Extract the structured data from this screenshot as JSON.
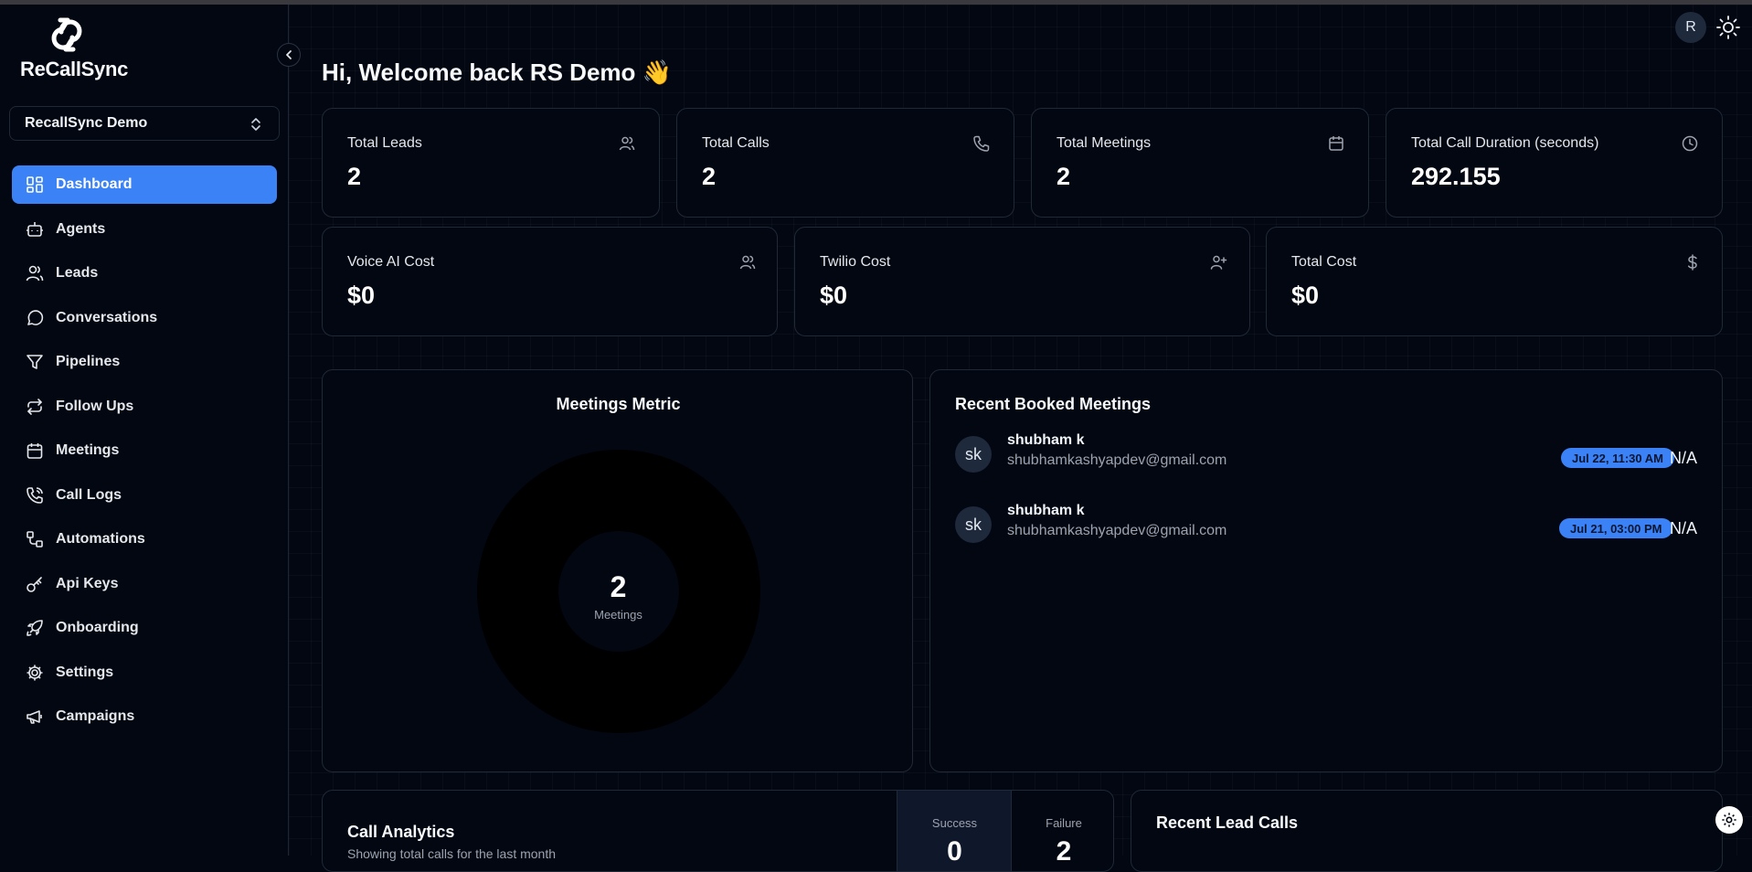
{
  "app": {
    "name": "ReCallSync"
  },
  "org_selector": {
    "value": "RecallSync Demo"
  },
  "nav": {
    "items": [
      {
        "label": "Dashboard",
        "icon": "layout-grid-icon",
        "active": true
      },
      {
        "label": "Agents",
        "icon": "bot-icon"
      },
      {
        "label": "Leads",
        "icon": "users-icon"
      },
      {
        "label": "Conversations",
        "icon": "message-circle-icon"
      },
      {
        "label": "Pipelines",
        "icon": "filter-icon"
      },
      {
        "label": "Follow Ups",
        "icon": "repeat-icon"
      },
      {
        "label": "Meetings",
        "icon": "calendar-icon"
      },
      {
        "label": "Call Logs",
        "icon": "phone-call-icon"
      },
      {
        "label": "Automations",
        "icon": "workflow-icon"
      },
      {
        "label": "Api Keys",
        "icon": "key-icon"
      },
      {
        "label": "Onboarding",
        "icon": "rocket-icon"
      },
      {
        "label": "Settings",
        "icon": "gear-icon"
      },
      {
        "label": "Campaigns",
        "icon": "megaphone-icon"
      }
    ]
  },
  "header": {
    "greeting": "Hi, Welcome back RS Demo 👋",
    "avatar_initial": "R"
  },
  "stats_row1": [
    {
      "label": "Total Leads",
      "value": "2",
      "icon": "users-icon"
    },
    {
      "label": "Total Calls",
      "value": "2",
      "icon": "phone-icon"
    },
    {
      "label": "Total Meetings",
      "value": "2",
      "icon": "calendar-icon"
    },
    {
      "label": "Total Call Duration (seconds)",
      "value": "292.155",
      "icon": "clock-icon"
    }
  ],
  "stats_row2": [
    {
      "label": "Voice AI Cost",
      "value": "$0",
      "icon": "users-icon"
    },
    {
      "label": "Twilio Cost",
      "value": "$0",
      "icon": "user-plus-icon"
    },
    {
      "label": "Total Cost",
      "value": "$0",
      "icon": "dollar-icon"
    }
  ],
  "meetings_metric": {
    "title": "Meetings Metric",
    "value": "2",
    "label": "Meetings"
  },
  "recent_meetings": {
    "title": "Recent Booked Meetings",
    "items": [
      {
        "initials": "sk",
        "name": "shubham k",
        "email": "shubhamkashyapdev@gmail.com",
        "time": "Jul 22, 11:30 AM",
        "status": "N/A"
      },
      {
        "initials": "sk",
        "name": "shubham k",
        "email": "shubhamkashyapdev@gmail.com",
        "time": "Jul 21, 03:00 PM",
        "status": "N/A"
      }
    ]
  },
  "call_analytics": {
    "title": "Call Analytics",
    "subtitle": "Showing total calls for the last month",
    "success_label": "Success",
    "success_value": "0",
    "failure_label": "Failure",
    "failure_value": "2"
  },
  "recent_lead_calls": {
    "title": "Recent Lead Calls"
  },
  "colors": {
    "accent": "#3b82f6",
    "background": "#030712",
    "card_border": "#1f2937"
  }
}
